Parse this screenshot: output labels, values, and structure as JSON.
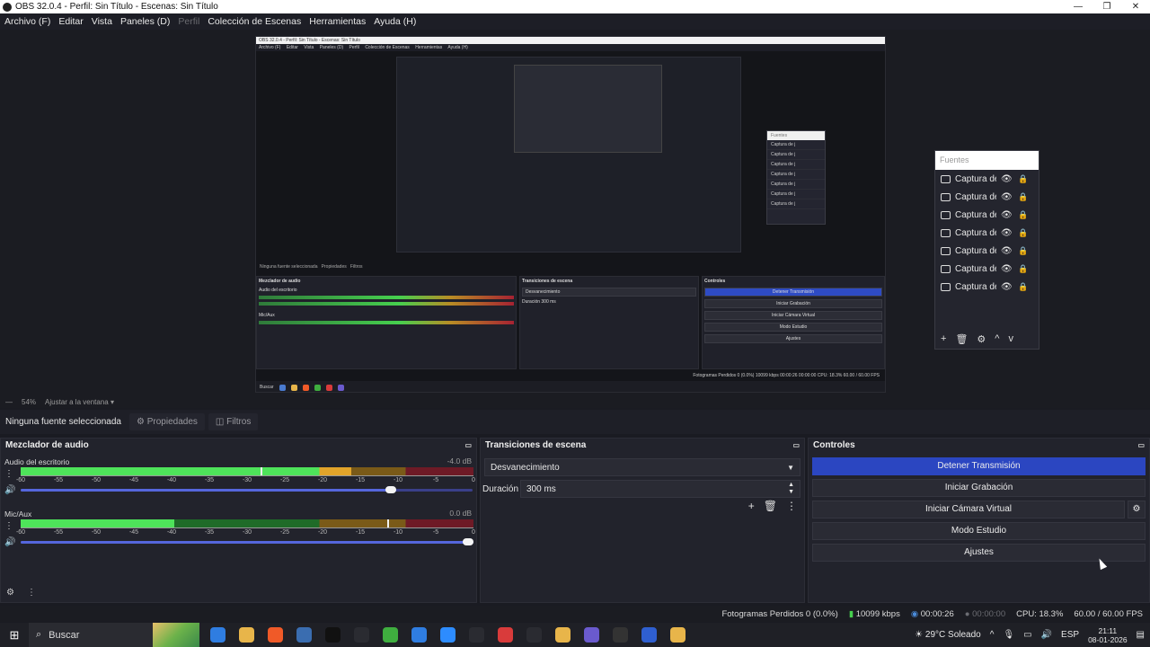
{
  "window": {
    "title": "OBS 32.0.4 - Perfil: Sin Título - Escenas: Sin Título",
    "controls": [
      "—",
      "❐",
      "✕"
    ]
  },
  "menu": [
    "Archivo (F)",
    "Editar",
    "Vista",
    "Paneles (D)",
    "Perfil",
    "Colección de Escenas",
    "Herramientas",
    "Ayuda (H)"
  ],
  "nested": {
    "title": "OBS 32.0.4 - Perfil: Sin Título - Escenas: Sin Título",
    "menu": [
      "Archivo (F)",
      "Editar",
      "Vista",
      "Paneles (D)",
      "Perfil",
      "Colección de Escenas",
      "Herramientas",
      "Ayuda (H)"
    ],
    "fuentes_header": "Fuentes",
    "fuentes_rows": [
      "Captura de j",
      "Captura de j",
      "Captura de j",
      "Captura de j",
      "Captura de j",
      "Captura de j",
      "Captura de j"
    ],
    "no_source": "Ninguna fuente seleccionada",
    "props": "Propiedades",
    "filters": "Filtros",
    "mixer_title": "Mezclador de audio",
    "desktop_audio": "Audio del escritorio",
    "mic": "Mic/Aux",
    "trans_title": "Transiciones de escena",
    "trans_value": "Desvanecimiento",
    "dur_label": "Duración",
    "dur_value": "300 ms",
    "ctrl_title": "Controles",
    "buttons": [
      "Detener Transmisión",
      "Iniciar Grabación",
      "Iniciar Cámara Virtual",
      "Modo Estudio",
      "Ajustes"
    ],
    "status": "Fotogramas Perdidos 0 (0.0%)   10099 kbps   00:00:26   00:00:00   CPU: 18.3%   60.00 / 60.00 FPS",
    "zoom": "54%",
    "fit": "Ajustar a la ventana",
    "search": "Buscar"
  },
  "fuentes": {
    "header": "Fuentes",
    "rows": [
      {
        "label": "Captura de j",
        "icon": "monitor-icon"
      },
      {
        "label": "Captura de j",
        "icon": "monitor-icon"
      },
      {
        "label": "Captura de j",
        "icon": "window-icon"
      },
      {
        "label": "Captura de j",
        "icon": "monitor-icon"
      },
      {
        "label": "Captura de j",
        "icon": "gamepad-icon"
      },
      {
        "label": "Captura de j",
        "icon": "window-icon"
      },
      {
        "label": "Captura de j",
        "icon": "window-icon"
      }
    ],
    "tools": [
      "+",
      "🗑",
      "⚙",
      "^",
      "v"
    ]
  },
  "zoombar": {
    "minus": "—",
    "zoom": "54%",
    "fit": "Ajustar a la ventana"
  },
  "sourcebar": {
    "none": "Ninguna fuente seleccionada",
    "properties": "Propiedades",
    "filters": "Filtros"
  },
  "mixer": {
    "title": "Mezclador de audio",
    "channels": [
      {
        "name": "Audio del escritorio",
        "db": "-4.0 dB",
        "level": 0.73,
        "peak": 0.53,
        "volume": 0.83
      },
      {
        "name": "Mic/Aux",
        "db": "0.0 dB",
        "level": 0.34,
        "peak": 0.81,
        "volume": 1.0
      }
    ],
    "scale": [
      "-60",
      "-55",
      "-50",
      "-45",
      "-40",
      "-35",
      "-30",
      "-25",
      "-20",
      "-15",
      "-10",
      "-5",
      "0"
    ]
  },
  "transitions": {
    "title": "Transiciones de escena",
    "selected": "Desvanecimiento",
    "duration_label": "Duración",
    "duration_value": "300 ms"
  },
  "controls": {
    "title": "Controles",
    "stop_stream": "Detener Transmisión",
    "start_recording": "Iniciar Grabación",
    "start_virtualcam": "Iniciar Cámara Virtual",
    "studio_mode": "Modo Estudio",
    "settings": "Ajustes"
  },
  "status": {
    "dropped": "Fotogramas Perdidos 0 (0.0%)",
    "bitrate": "10099 kbps",
    "stream_time": "00:00:26",
    "rec_time": "00:00:00",
    "cpu": "CPU: 18.3%",
    "fps": "60.00 / 60.00 FPS"
  },
  "taskbar": {
    "search": "Buscar",
    "weather": "29°C  Soleado",
    "lang": "ESP",
    "time": "21:11",
    "date": "08-01-2026",
    "app_colors": [
      "#2f7de1",
      "#e8b54a",
      "#f05a28",
      "#3a6db0",
      "#111111",
      "#2a2b31",
      "#3fae3f",
      "#2f7de1",
      "#2d8cff",
      "#2a2b31",
      "#d93b3b",
      "#2a2b31",
      "#e8b54a",
      "#6a5acd",
      "#333333",
      "#2f5fd0",
      "#e8b54a"
    ]
  }
}
